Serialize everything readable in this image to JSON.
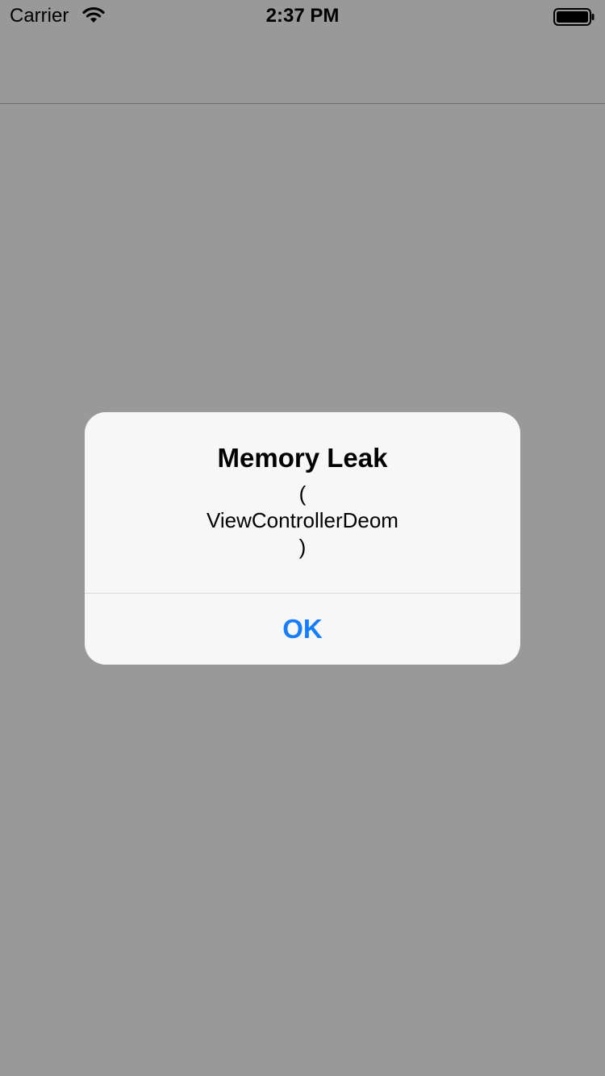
{
  "status_bar": {
    "carrier": "Carrier",
    "time": "2:37 PM",
    "wifi_icon": "wifi-icon",
    "battery_icon": "battery-icon"
  },
  "alert": {
    "title": "Memory Leak",
    "message_lines": [
      "(",
      "ViewControllerDeom",
      ")"
    ],
    "ok_label": "OK",
    "accent_color": "#147efb"
  },
  "colors": {
    "dimmed_background": "#999999",
    "alert_background": "#f7f7f7"
  }
}
